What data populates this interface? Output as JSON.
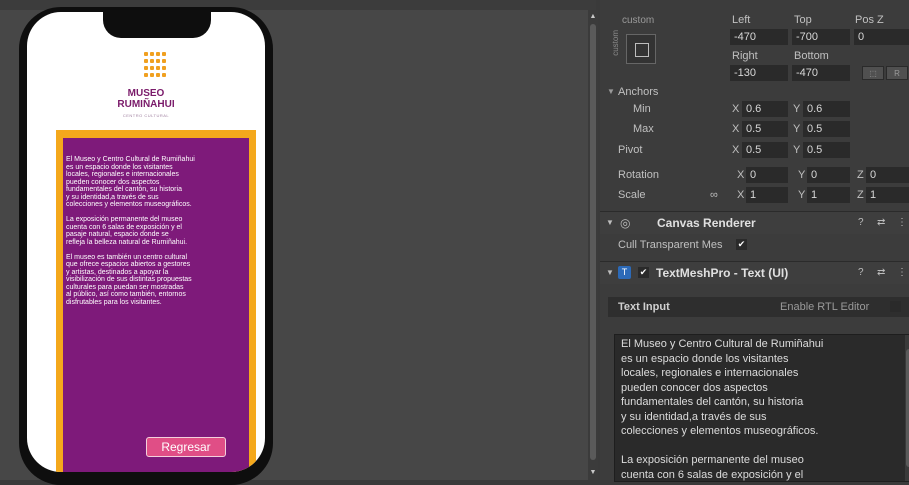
{
  "app": {
    "button_label": "Regresar"
  },
  "museum": {
    "title_line1": "MUSEO",
    "title_line2": "RUMIÑAHUI",
    "subtitle": "CENTRO CULTURAL",
    "panel_text": "El Museo y Centro Cultural de Rumiñahui\nes un espacio donde los visitantes\nlocales, regionales e internacionales\npueden conocer dos aspectos\nfundamentales del cantón, su historia\ny su identidad,a través de sus\ncolecciones y elementos museográficos.\n\nLa exposición permanente del museo\ncuenta con 6 salas de exposición y el\npasaje natural, espacio donde se\nrefleja la belleza natural de Rumiñahui.\n\nEl museo es también un centro cultural\nque ofrece espacios abiertos a gestores\ny artistas, destinados a apoyar la\nvisibilización de sus distintas propuestas\nculturales para puedan ser mostradas\nal público, así como también, entornos\ndisfrutables para los visitantes."
  },
  "rect_transform": {
    "preset_label": "custom",
    "preset_side_label": "custom",
    "left_label": "Left",
    "left_value": "-470",
    "top_label": "Top",
    "top_value": "-700",
    "posz_label": "Pos Z",
    "posz_value": "0",
    "right_label": "Right",
    "right_value": "-130",
    "bottom_label": "Bottom",
    "bottom_value": "-470",
    "anchors_label": "Anchors",
    "min_label": "Min",
    "min_x_label": "X",
    "min_x": "0.6",
    "min_y_label": "Y",
    "min_y": "0.6",
    "max_label": "Max",
    "max_x_label": "X",
    "max_x": "0.5",
    "max_y_label": "Y",
    "max_y": "0.5",
    "pivot_label": "Pivot",
    "pivot_x_label": "X",
    "pivot_x": "0.5",
    "pivot_y_label": "Y",
    "pivot_y": "0.5",
    "rotation_label": "Rotation",
    "rot_x_label": "X",
    "rot_x": "0",
    "rot_y_label": "Y",
    "rot_y": "0",
    "rot_z_label": "Z",
    "rot_z": "0",
    "scale_label": "Scale",
    "scale_x_label": "X",
    "scale_x": "1",
    "scale_y_label": "Y",
    "scale_y": "1",
    "scale_z_label": "Z",
    "scale_z": "1",
    "raw_button": "R"
  },
  "canvas_renderer": {
    "title": "Canvas Renderer",
    "cull_label": "Cull Transparent Mes",
    "cull_checked": "✔"
  },
  "textmeshpro": {
    "title": "TextMeshPro - Text (UI)",
    "enabled_check": "✔",
    "icon_letter": "T",
    "text_input_label": "Text Input",
    "rtl_label": "Enable RTL Editor",
    "text_value": "El Museo y Centro Cultural de Rumiñahui\nes un espacio donde los visitantes\nlocales, regionales e internacionales\npueden conocer dos aspectos\nfundamentales del cantón, su historia\ny su identidad,a través de sus\ncolecciones y elementos museográficos.\n\nLa exposición permanente del museo\ncuenta con 6 salas de exposición y el\npasaje natural, espacio donde se"
  },
  "icons": {
    "foldout": "▼",
    "help": "?",
    "settings": "⇄",
    "menu": "⋮",
    "eye": "◎",
    "link": "∞",
    "scroll_up": "▲",
    "scroll_down": "▼"
  },
  "colors": {
    "panel_purple": "#7e1a7a",
    "panel_orange": "#f4a81c",
    "button_pink": "#e04e86",
    "editor_bg": "#3c3c3c"
  }
}
